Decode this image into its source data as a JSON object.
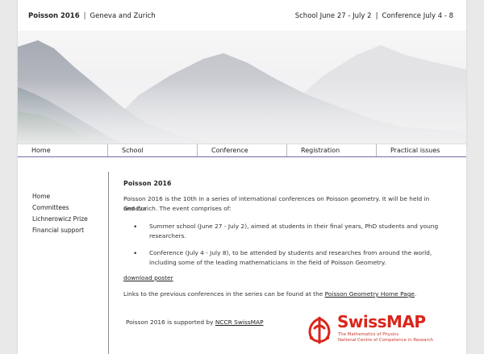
{
  "header": {
    "brand": "Poisson 2016",
    "location": "Geneva and Zurich",
    "school": "School June 27 - July 2",
    "conference": "Conference July 4 - 8",
    "separator": "|"
  },
  "nav": {
    "items": [
      {
        "label": "Home"
      },
      {
        "label": "School"
      },
      {
        "label": "Conference"
      },
      {
        "label": "Registration"
      },
      {
        "label": "Practical issues"
      }
    ]
  },
  "sidebar": {
    "items": [
      {
        "label": "Home"
      },
      {
        "label": "Committees"
      },
      {
        "label": "Lichnerowicz Prize"
      },
      {
        "label": "Financial support"
      }
    ]
  },
  "main": {
    "title": "Poisson 2016",
    "intro_line1": "Poisson 2016 is the 10th in a series of international conferences on Poisson geometry. It will be held in Geneva",
    "intro_line2": "and Zurich. The event comprises of:",
    "bullets": [
      {
        "line1": "Summer school (June 27 - July 2), aimed at students in their final years, PhD students and young",
        "line2": "researchers."
      },
      {
        "line1": "Conference (July 4 - July 8), to be attended by students and researches from around the world,",
        "line2": "including some of the leading mathematicians in the field of Poisson Geometry."
      }
    ],
    "download": "download poster",
    "links_prefix": "Links to the previous conferences in the series can be found at the ",
    "links_link": "Poisson Geometry Home Page",
    "links_suffix": ".",
    "supported_prefix": "Poisson 2016 is supported by ",
    "supported_link": "NCCR SwissMAP"
  },
  "logo": {
    "name": "SwissMAP",
    "line1": "The Mathematics of Physics",
    "line2": "National Centre of Competence in Research"
  },
  "colors": {
    "nav_underline": "#6e6ea8",
    "logo_red": "#d9261c"
  }
}
